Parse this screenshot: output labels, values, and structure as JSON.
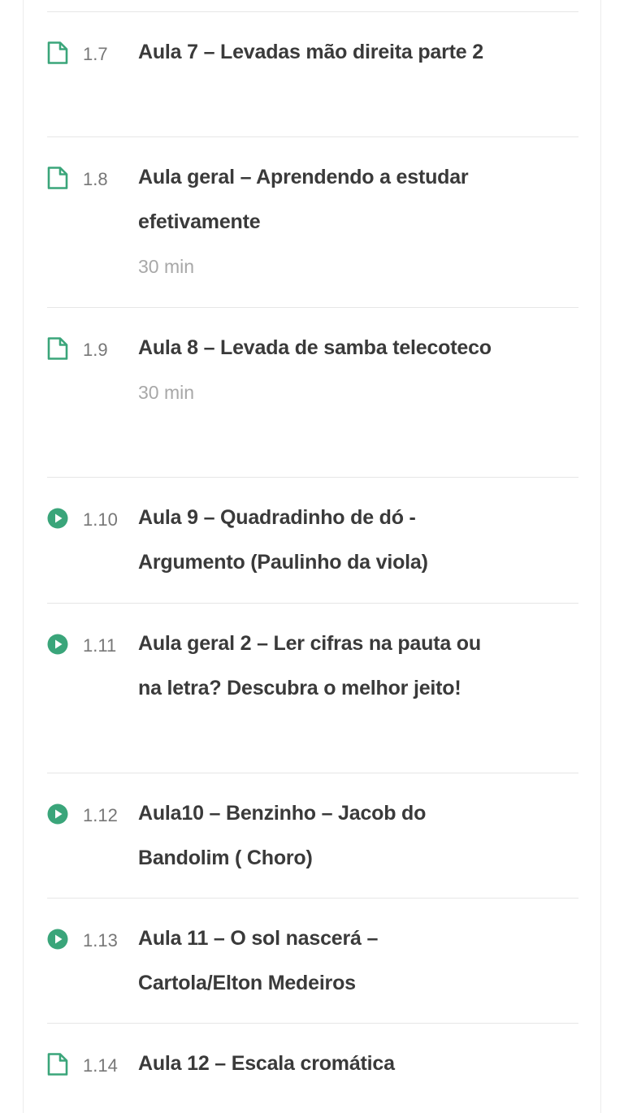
{
  "colors": {
    "accent": "#3aa57a",
    "title": "#3a3a3a",
    "number": "#777777",
    "meta": "#a8a8a8",
    "divider": "#e6e6e6"
  },
  "lessons": [
    {
      "number": "1.7",
      "icon": "document-icon",
      "title": "Aula 7 – Levadas mão direita parte 2",
      "duration": ""
    },
    {
      "number": "1.8",
      "icon": "document-icon",
      "title": "Aula geral – Aprendendo a estudar efetivamente",
      "duration": "30 min"
    },
    {
      "number": "1.9",
      "icon": "document-icon",
      "title": "Aula 8 – Levada de samba telecoteco",
      "duration": "30 min"
    },
    {
      "number": "1.10",
      "icon": "play-icon",
      "title": "Aula 9 – Quadradinho de dó - Argumento (Paulinho da viola)",
      "duration": ""
    },
    {
      "number": "1.11",
      "icon": "play-icon",
      "title": "Aula geral 2 – Ler cifras na pauta ou na letra? Descubra o melhor jeito!",
      "duration": ""
    },
    {
      "number": "1.12",
      "icon": "play-icon",
      "title": "Aula10 – Benzinho – Jacob do Bandolim ( Choro)",
      "duration": ""
    },
    {
      "number": "1.13",
      "icon": "play-icon",
      "title": "Aula 11 – O sol nascerá – Cartola/Elton Medeiros",
      "duration": ""
    },
    {
      "number": "1.14",
      "icon": "document-icon",
      "title": "Aula 12 – Escala cromática",
      "duration": ""
    }
  ]
}
